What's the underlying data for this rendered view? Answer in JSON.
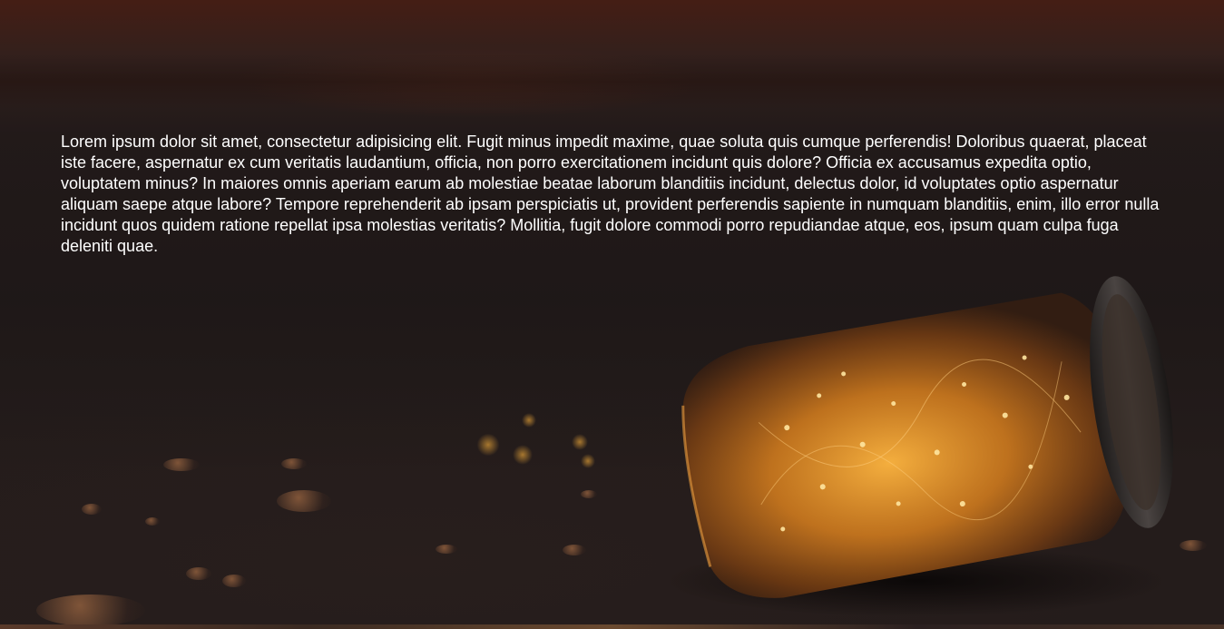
{
  "hero": {
    "paragraph": "Lorem ipsum dolor sit amet, consectetur adipisicing elit. Fugit minus impedit maxime, quae soluta quis cumque perferendis! Doloribus quaerat, placeat iste facere, aspernatur ex cum veritatis laudantium, officia, non porro exercitationem incidunt quis dolore? Officia ex accusamus expedita optio, voluptatem minus? In maiores omnis aperiam earum ab molestiae beatae laborum blanditiis incidunt, delectus dolor, id voluptates optio aspernatur aliquam saepe atque labore? Tempore reprehenderit ab ipsam perspiciatis ut, provident perferendis sapiente in numquam blanditiis, enim, illo error nulla incidunt quos quidem ratione repellat ipsa molestias veritatis? Mollitia, fugit dolore commodi porro repudiandae atque, eos, ipsum quam culpa fuga deleniti quae.",
    "background_colors": {
      "sky": "#48201a",
      "sand": "#241c1b",
      "jar_glow": "#e08a24",
      "lid": "#2e2a28"
    }
  }
}
